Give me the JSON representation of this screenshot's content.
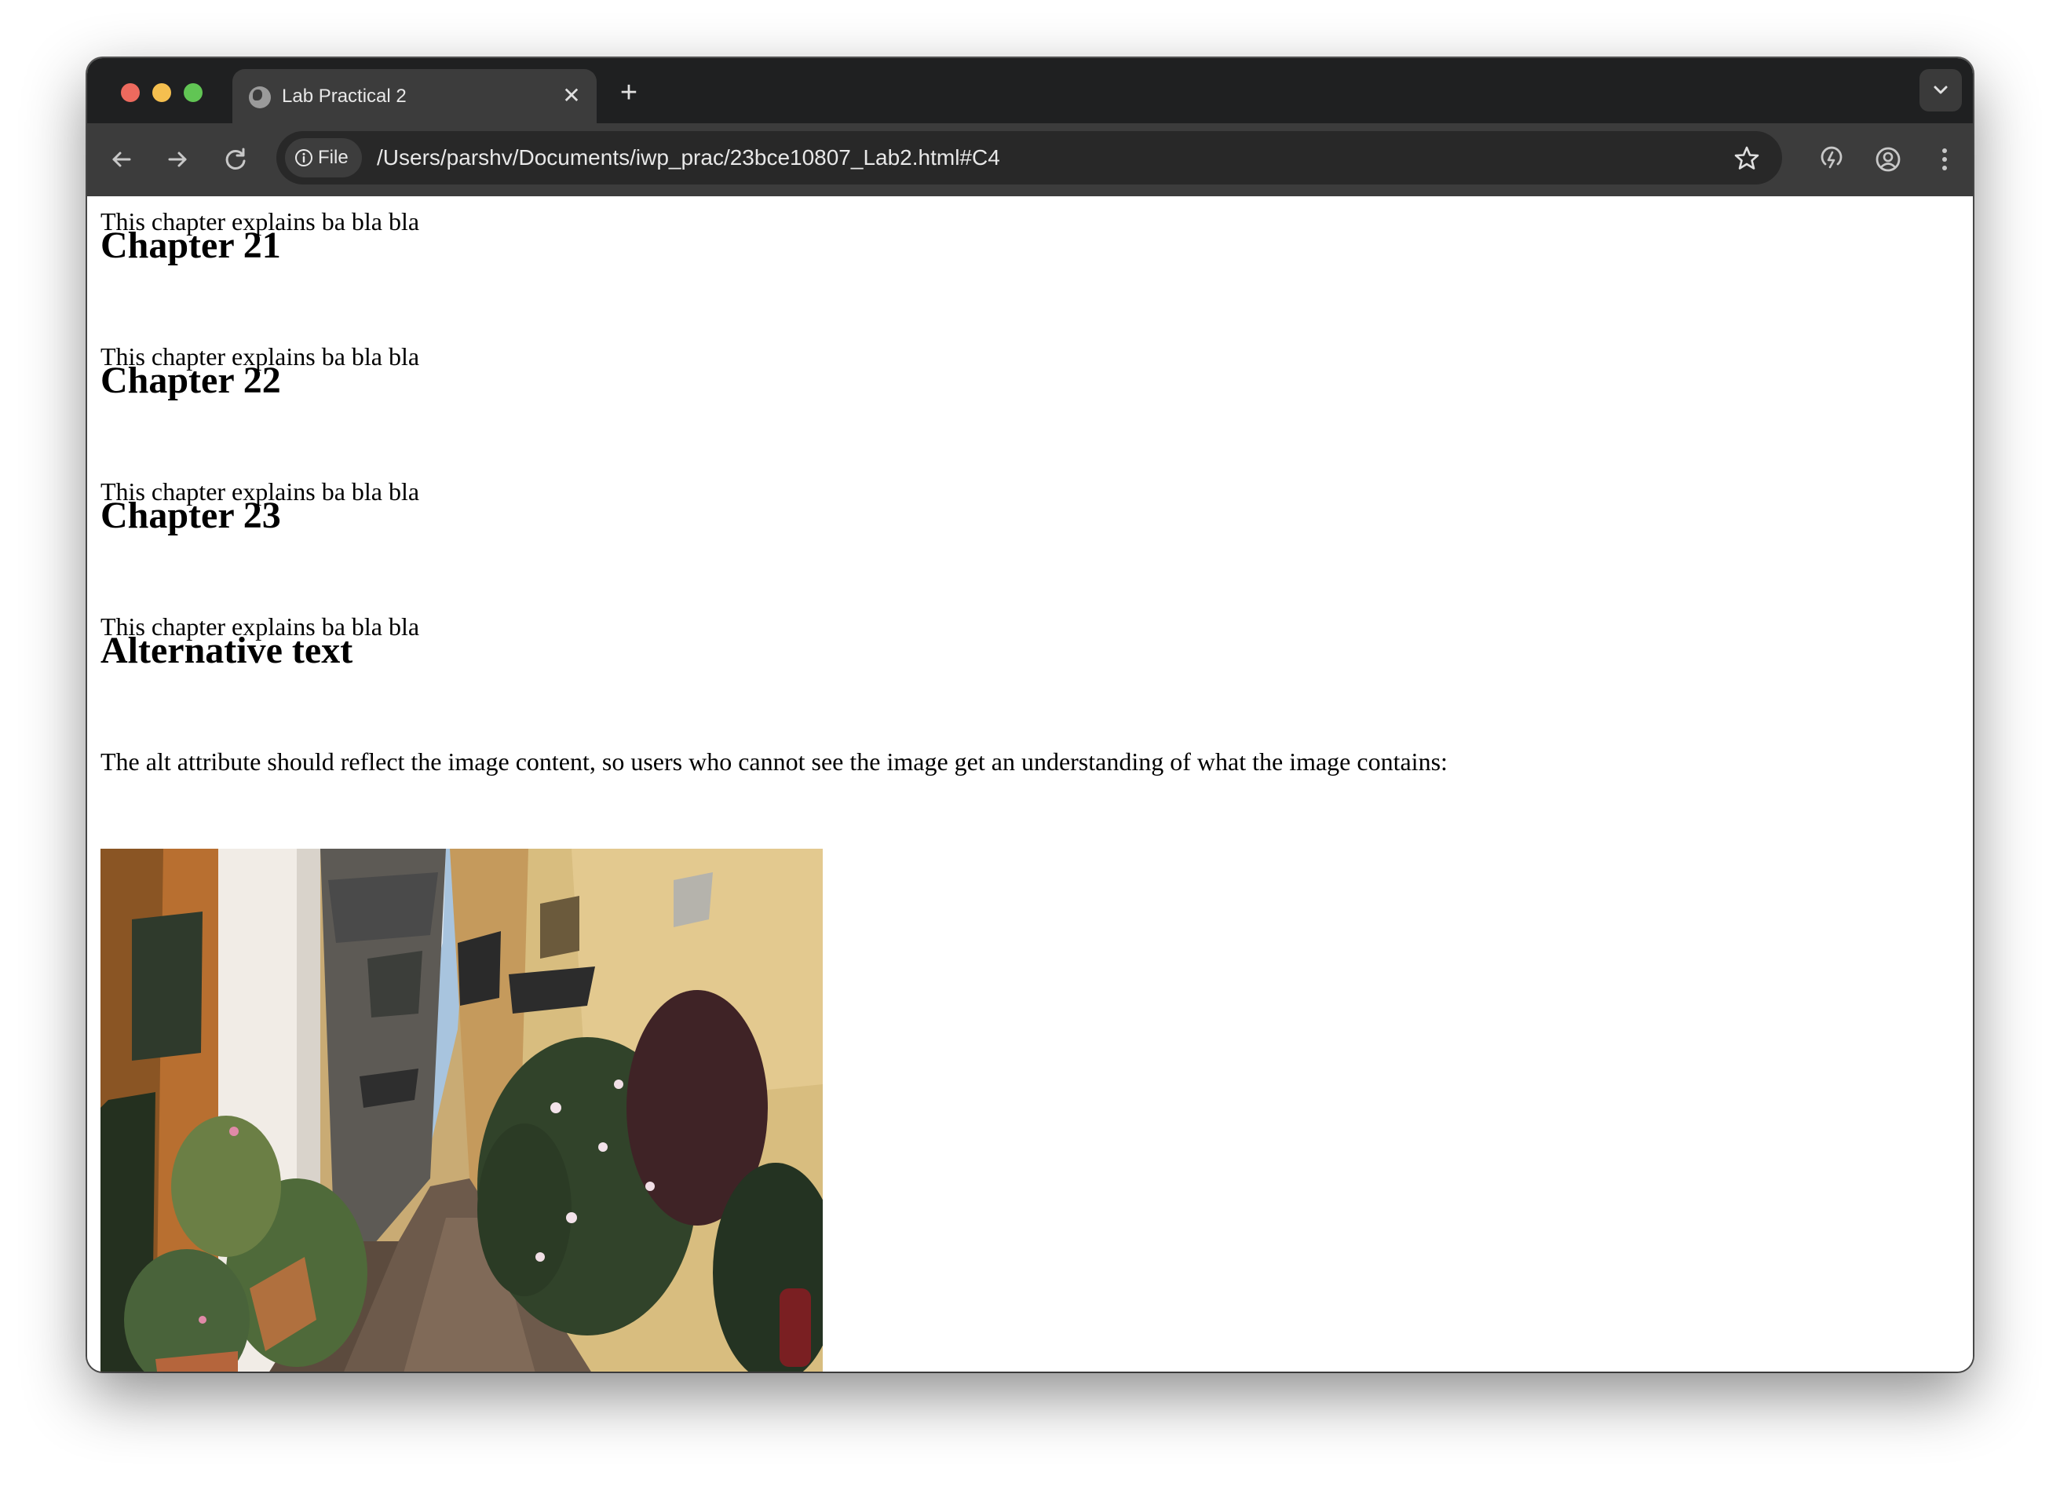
{
  "browser": {
    "tab_title": "Lab Practical 2",
    "tab_close_symbol": "✕",
    "new_tab_symbol": "+",
    "security_chip_label": "File",
    "url": "/Users/parshv/Documents/iwp_prac/23bce10807_Lab2.html#C4",
    "icons": [
      "globe-icon",
      "close-icon",
      "plus-icon",
      "chevron-down-icon",
      "back-arrow-icon",
      "forward-arrow-icon",
      "reload-icon",
      "info-icon",
      "star-icon",
      "performance-icon",
      "profile-icon",
      "kebab-menu-icon"
    ]
  },
  "page": {
    "intro_paragraph": "This chapter explains ba bla bla",
    "chapters": [
      {
        "heading": "Chapter 21",
        "text": "This chapter explains ba bla bla"
      },
      {
        "heading": "Chapter 22",
        "text": "This chapter explains ba bla bla"
      },
      {
        "heading": "Chapter 23",
        "text": "This chapter explains ba bla bla"
      }
    ],
    "alt_section": {
      "heading": "Alternative text",
      "text": "The alt attribute should reflect the image content, so users who cannot see the image get an understanding of what the image contains:"
    }
  },
  "colors": {
    "titlebar": "#1f2021",
    "toolbar": "#3c3c3c",
    "omnibox": "#282828"
  }
}
